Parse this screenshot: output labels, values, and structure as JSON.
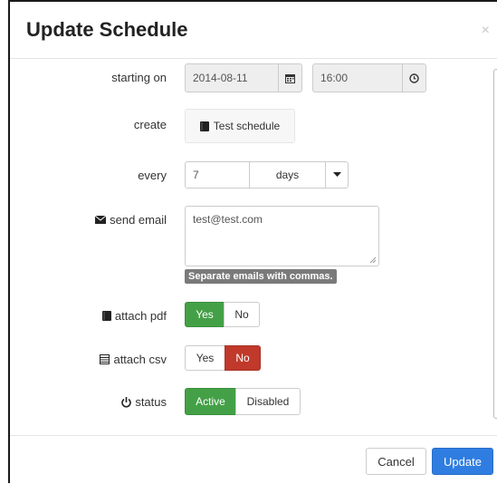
{
  "modal": {
    "title": "Update Schedule",
    "close_label": "×"
  },
  "form": {
    "starting_on": {
      "label": "starting on",
      "date_value": "2014-08-11",
      "time_value": "16:00",
      "date_icon": "calendar-icon",
      "time_icon": "clock-icon"
    },
    "create": {
      "label": "create",
      "button_label": "Test schedule",
      "icon": "book-icon"
    },
    "every": {
      "label": "every",
      "value": "7",
      "unit": "days"
    },
    "send_email": {
      "label": "send email",
      "icon": "envelope-icon",
      "value": "test@test.com",
      "hint": "Separate emails with commas."
    },
    "attach_pdf": {
      "label": "attach pdf",
      "icon": "book-icon",
      "yes_label": "Yes",
      "no_label": "No",
      "selected": "Yes"
    },
    "attach_csv": {
      "label": "attach csv",
      "icon": "list-icon",
      "yes_label": "Yes",
      "no_label": "No",
      "selected": "No"
    },
    "status": {
      "label": "status",
      "icon": "power-icon",
      "active_label": "Active",
      "disabled_label": "Disabled",
      "selected": "Active"
    }
  },
  "footer": {
    "cancel_label": "Cancel",
    "update_label": "Update"
  },
  "colors": {
    "success": "#44a047",
    "danger": "#c0392b",
    "primary": "#2f7de1"
  }
}
